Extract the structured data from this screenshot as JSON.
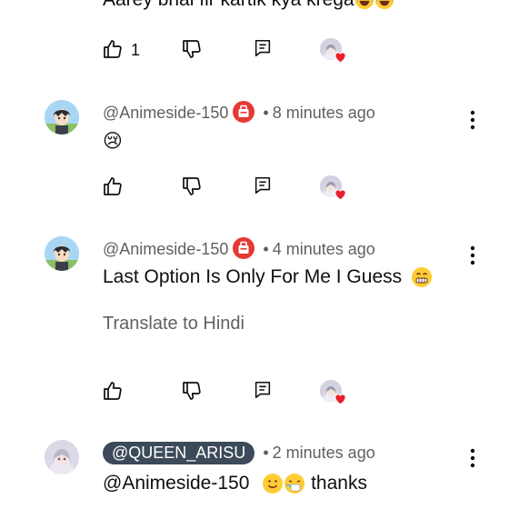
{
  "top_comment": {
    "text": "Aarey bhai fir kartik kya krega",
    "like_count": "1"
  },
  "comments": [
    {
      "handle": "@Animeside-150",
      "time": "8 minutes ago",
      "text": "😢"
    },
    {
      "handle": "@Animeside-150",
      "time": "4 minutes ago",
      "text": "Last Option Is Only For Me I Guess",
      "translate": "Translate to Hindi"
    },
    {
      "handle": "@QUEEN_ARISU",
      "time": "2 minutes ago",
      "text_mention": "@Animeside-150",
      "text_rest": "thanks"
    }
  ],
  "separator": "•",
  "icons": {
    "like": "thumbs-up-icon",
    "dislike": "thumbs-down-icon",
    "reply": "reply-icon",
    "creator_heart": "creator-heart-icon",
    "more": "more-vert-icon",
    "badge": "member-badge-icon"
  },
  "colors": {
    "heart": "#e91e2b",
    "badge": "#e53935",
    "meta": "#606060",
    "pill": "#3c4a5a"
  }
}
